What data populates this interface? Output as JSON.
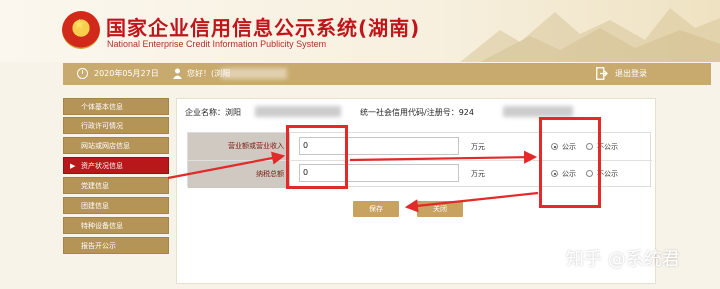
{
  "header": {
    "title": "国家企业信用信息公示系统(湖南)",
    "subtitle": "National Enterprise Credit Information Publicity System"
  },
  "statusbar": {
    "date": "2020年05月27日",
    "greeting": "您好！(浏阳",
    "logout": "退出登录"
  },
  "sidebar": {
    "items": [
      {
        "label": "个体基本信息",
        "active": false
      },
      {
        "label": "行政许可情况",
        "active": false
      },
      {
        "label": "网站或网店信息",
        "active": false
      },
      {
        "label": "资产状况信息",
        "active": true
      },
      {
        "label": "党建信息",
        "active": false
      },
      {
        "label": "团建信息",
        "active": false
      },
      {
        "label": "特种设备信息",
        "active": false
      },
      {
        "label": "报告开公示",
        "active": false
      }
    ]
  },
  "main": {
    "company_label": "企业名称：浏阳",
    "credit_label": "统一社会信用代码/注册号：924",
    "rows": [
      {
        "label": "营业额或营业收入",
        "value": "0",
        "unit": "万元",
        "public": "公示",
        "private": "不公示"
      },
      {
        "label": "纳税总额",
        "value": "0",
        "unit": "万元",
        "public": "公示",
        "private": "不公示"
      }
    ],
    "save": "保存",
    "close": "关闭"
  },
  "watermark": "知乎 @系统君",
  "colors": {
    "accent": "#c8aa6e",
    "active": "#b8181a",
    "title": "#c0161b",
    "annotation": "#e22a2a"
  }
}
